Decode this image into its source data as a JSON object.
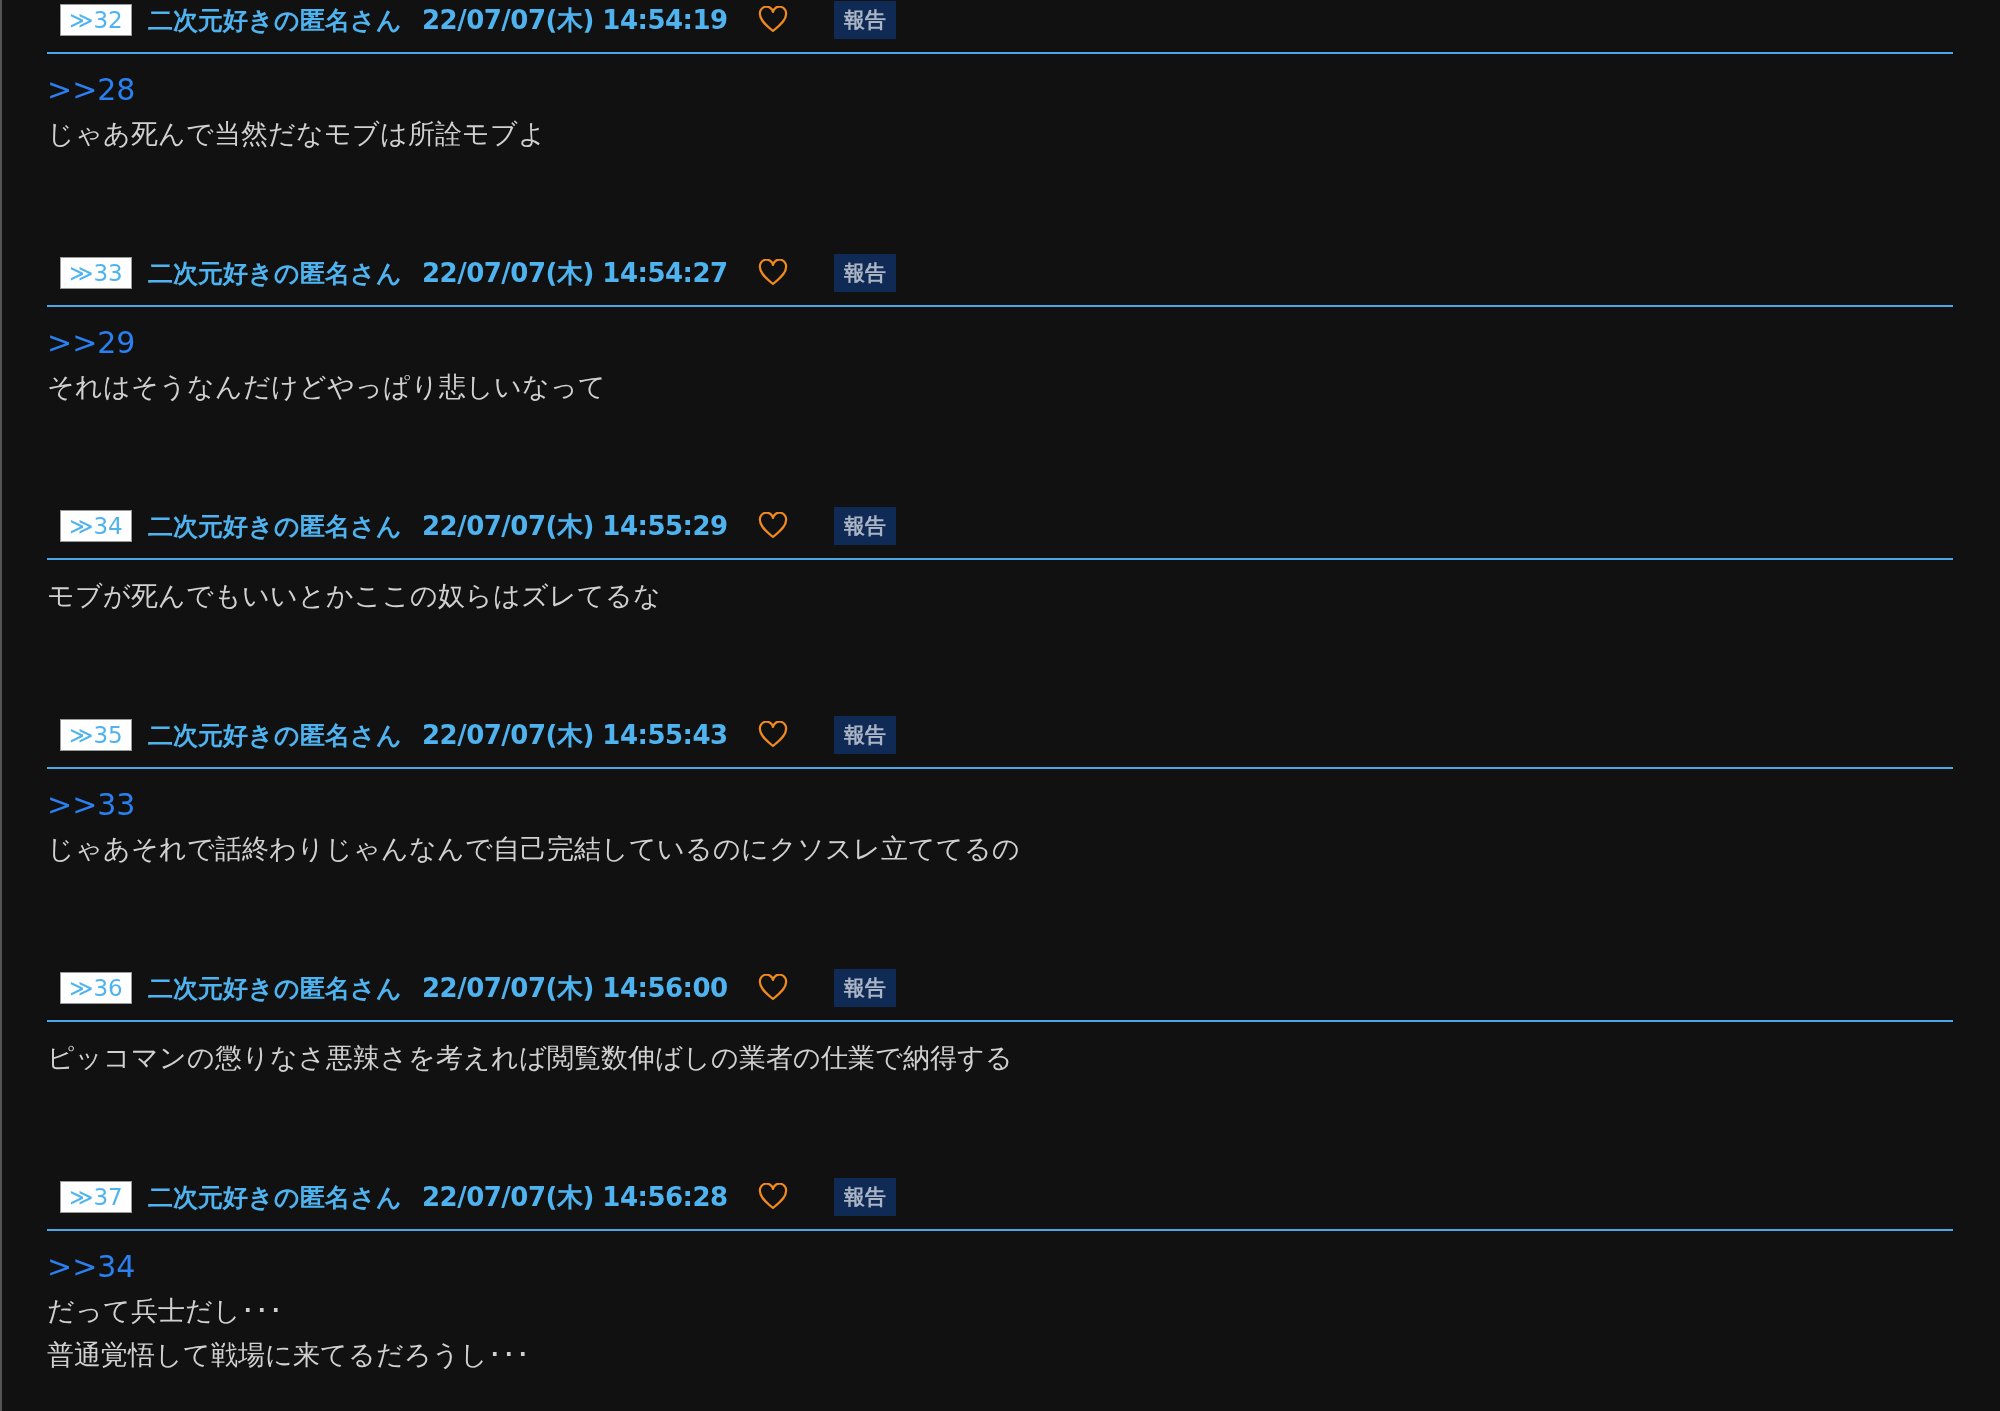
{
  "posts": [
    {
      "number": "≫32",
      "name": "二次元好きの匿名さん",
      "date": "22/07/07(木) 14:54:19",
      "report": "報告",
      "reply": ">>28",
      "lines": [
        "じゃあ死んで当然だなモブは所詮モブよ"
      ]
    },
    {
      "number": "≫33",
      "name": "二次元好きの匿名さん",
      "date": "22/07/07(木) 14:54:27",
      "report": "報告",
      "reply": ">>29",
      "lines": [
        "それはそうなんだけどやっぱり悲しいなって"
      ]
    },
    {
      "number": "≫34",
      "name": "二次元好きの匿名さん",
      "date": "22/07/07(木) 14:55:29",
      "report": "報告",
      "lines": [
        "モブが死んでもいいとかここの奴らはズレてるな"
      ]
    },
    {
      "number": "≫35",
      "name": "二次元好きの匿名さん",
      "date": "22/07/07(木) 14:55:43",
      "report": "報告",
      "reply": ">>33",
      "lines": [
        "じゃあそれで話終わりじゃんなんで自己完結しているのにクソスレ立ててるの"
      ]
    },
    {
      "number": "≫36",
      "name": "二次元好きの匿名さん",
      "date": "22/07/07(木) 14:56:00",
      "report": "報告",
      "lines": [
        "ピッコマンの懲りなさ悪辣さを考えれば閲覧数伸ばしの業者の仕業で納得する"
      ]
    },
    {
      "number": "≫37",
      "name": "二次元好きの匿名さん",
      "date": "22/07/07(木) 14:56:28",
      "report": "報告",
      "reply": ">>34",
      "lines": [
        "だって兵士だし･･･",
        "普通覚悟して戦場に来てるだろうし･･･"
      ]
    }
  ]
}
